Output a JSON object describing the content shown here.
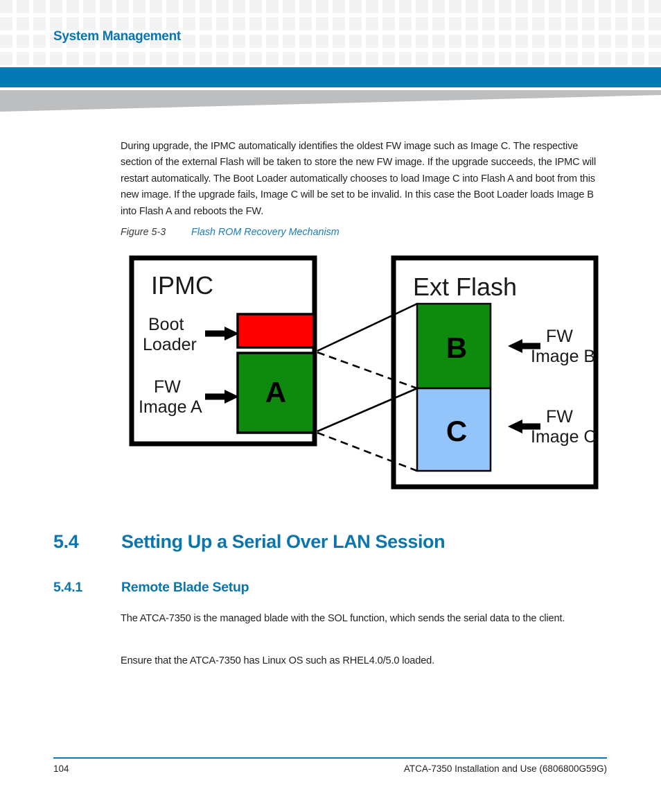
{
  "header": {
    "title": "System Management",
    "accent_color": "#0579b4",
    "title_color": "#0b76ad",
    "pattern_square_color": "#f3f3f3",
    "wedge_color": "#bcbec0"
  },
  "body": {
    "intro_paragraph": "During upgrade, the IPMC automatically identifies the oldest FW image such as Image C. The respective section of the external Flash will be taken to store the new FW image. If the upgrade succeeds, the IPMC will restart automatically. The Boot Loader automatically chooses to load Image C into Flash A and boot from this new image. If the upgrade fails, Image C will be set to be invalid. In this case the Boot Loader loads Image B into Flash A and reboots the FW.",
    "sol_paragraph": "The ATCA-7350 is the managed blade with the SOL function, which sends the serial data to the client.",
    "linux_paragraph": "Ensure that the ATCA-7350 has Linux OS such as RHEL4.0/5.0 loaded."
  },
  "figure": {
    "caption_number": "Figure 5-3",
    "caption_title": "Flash ROM Recovery Mechanism",
    "ipmc": {
      "box_label": "IPMC",
      "boot_loader_label": "Boot\nLoader",
      "boot_loader_label_line1": "Boot",
      "boot_loader_label_line2": "Loader",
      "fw_image_a_label_line1": "FW",
      "fw_image_a_label_line2": "Image A",
      "boot_block_color": "#ff0000",
      "image_a_block_color": "#0e8a0e",
      "image_a_letter": "A"
    },
    "ext_flash": {
      "box_label": "Ext Flash",
      "image_b_letter": "B",
      "image_b_color": "#0e8a0e",
      "image_c_letter": "C",
      "image_c_color": "#93c5fa",
      "fw_image_b_label_line1": "FW",
      "fw_image_b_label_line2": "Image B",
      "fw_image_c_label_line1": "FW",
      "fw_image_c_label_line2": "Image C"
    }
  },
  "sections": {
    "h1_number": "5.4",
    "h1_title": "Setting Up a Serial Over LAN Session",
    "h2_number": "5.4.1",
    "h2_title": "Remote Blade Setup"
  },
  "footer": {
    "page_number": "104",
    "document_title": "ATCA-7350 Installation and Use (6806800G59G)",
    "rule_color": "#0579b4"
  }
}
